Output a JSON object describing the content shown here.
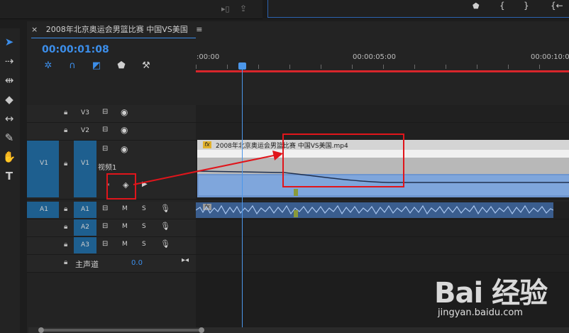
{
  "sequence": {
    "tab_title": "2008年北京奥运会男篮比赛 中国VS美国",
    "close_glyph": "×",
    "menu_glyph": "≡",
    "timecode": "00:00:01:08"
  },
  "ruler": {
    "labels": [
      ":00:00",
      "00:00:05:00",
      "00:00:10:0"
    ]
  },
  "tracks": {
    "video": [
      {
        "target": "",
        "name": "V3"
      },
      {
        "target": "",
        "name": "V2"
      },
      {
        "target": "V1",
        "name": "V1",
        "sub_label": "视频1"
      }
    ],
    "audio": [
      {
        "target": "A1",
        "name": "A1",
        "mute": "M",
        "solo": "S"
      },
      {
        "target": "",
        "name": "A2",
        "mute": "M",
        "solo": "S"
      },
      {
        "target": "",
        "name": "A3",
        "mute": "M",
        "solo": "S"
      }
    ],
    "master": {
      "label": "主声道",
      "value": "0.0"
    }
  },
  "clip": {
    "fx": "fx",
    "name": "2008年北京奥运会男篮比赛 中国VS美国.mp4"
  },
  "watermark": {
    "logo": "Bai 经验",
    "url": "jingyan.baidu.com"
  },
  "colors": {
    "accent": "#3c8eea",
    "playhead": "#4c97ea",
    "work_area": "#d8262b",
    "annotation": "#e0151b",
    "clip_video": "#7fa6dc",
    "clip_audio": "#3a5d8e"
  }
}
